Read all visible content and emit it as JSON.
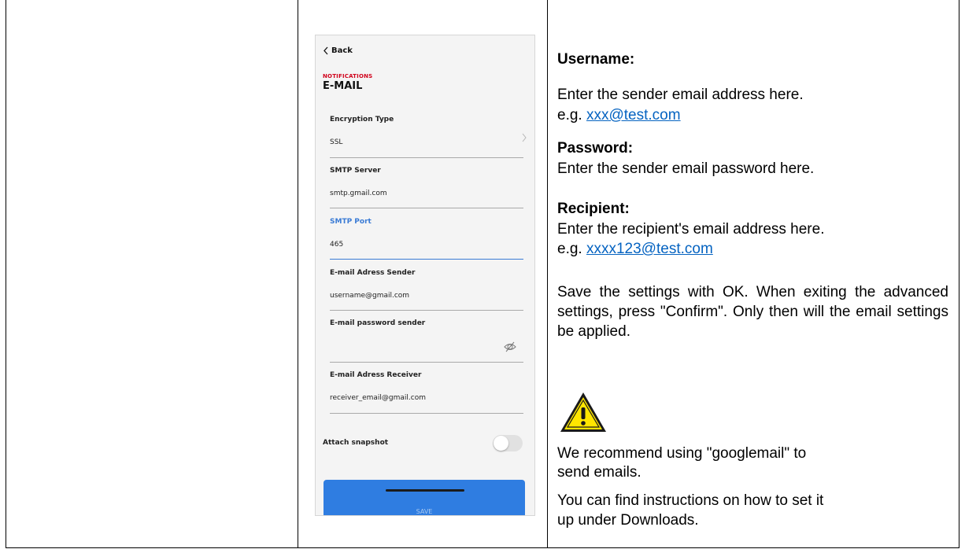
{
  "phone": {
    "back_label": "Back",
    "section": "NOTIFICATIONS",
    "title": "E-MAIL",
    "fields": [
      {
        "label": "Encryption Type",
        "value": "SSL"
      },
      {
        "label": "SMTP Server",
        "value": "smtp.gmail.com"
      },
      {
        "label": "SMTP Port",
        "value": "465"
      },
      {
        "label": "E-mail Adress Sender",
        "value": "username@gmail.com"
      },
      {
        "label": "E-mail password sender",
        "value": ""
      },
      {
        "label": "E-mail Adress Receiver",
        "value": "receiver_email@gmail.com"
      }
    ],
    "attach_snapshot_label": "Attach snapshot",
    "attach_snapshot_on": false,
    "save_label": "SAVE",
    "accent_color": "#2f7de1",
    "section_color": "#d0021b"
  },
  "instructions": {
    "username_heading": "Username:",
    "username_text": "Enter the sender email address here.",
    "username_eg": "e.g.",
    "username_link": "xxx@test.com",
    "password_heading": "Password:",
    "password_text": "Enter the sender email password here.",
    "recipient_heading": "Recipient:",
    "recipient_text": "Enter the recipient's email address here.",
    "recipient_eg": "e.g.",
    "recipient_link": "xxxx123@test.com",
    "save_paragraph": "Save the settings with OK. When exiting the advanced settings, press \"Confirm\". Only then will the email settings be applied.",
    "warning_icon": "warning-triangle-icon",
    "recommend_line1": "We recommend using \"googlemail\" to",
    "recommend_line2": "send emails.",
    "downloads_line1": "You can find instructions on how to set it",
    "downloads_line2": "up under Downloads."
  }
}
